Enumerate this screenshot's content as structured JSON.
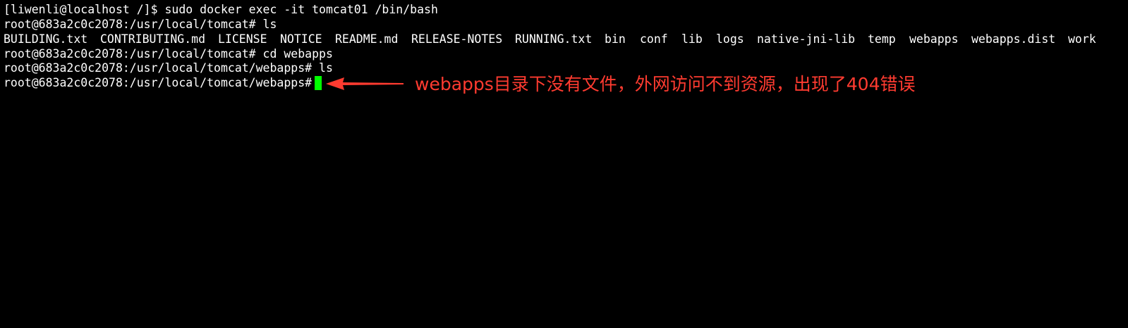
{
  "terminal": {
    "lines": [
      "[liwenli@localhost /]$ sudo docker exec -it tomcat01 /bin/bash",
      "root@683a2c0c2078:/usr/local/tomcat# ls",
      "",
      "root@683a2c0c2078:/usr/local/tomcat# cd webapps",
      "root@683a2c0c2078:/usr/local/tomcat/webapps# ls",
      "root@683a2c0c2078:/usr/local/tomcat/webapps# "
    ],
    "ls_output": [
      "BUILDING.txt",
      "CONTRIBUTING.md",
      "LICENSE",
      "NOTICE",
      "README.md",
      "RELEASE-NOTES",
      "RUNNING.txt",
      "bin",
      "conf",
      "lib",
      "logs",
      "native-jni-lib",
      "temp",
      "webapps",
      "webapps.dist",
      "work"
    ],
    "cursor_color": "#00ff00",
    "text_color": "#ffffff",
    "background_color": "#000000"
  },
  "annotation": {
    "text": "webapps目录下没有文件，外网访问不到资源，出现了404错误",
    "color": "#ff3b30",
    "arrow_icon": "arrow-left-icon"
  }
}
